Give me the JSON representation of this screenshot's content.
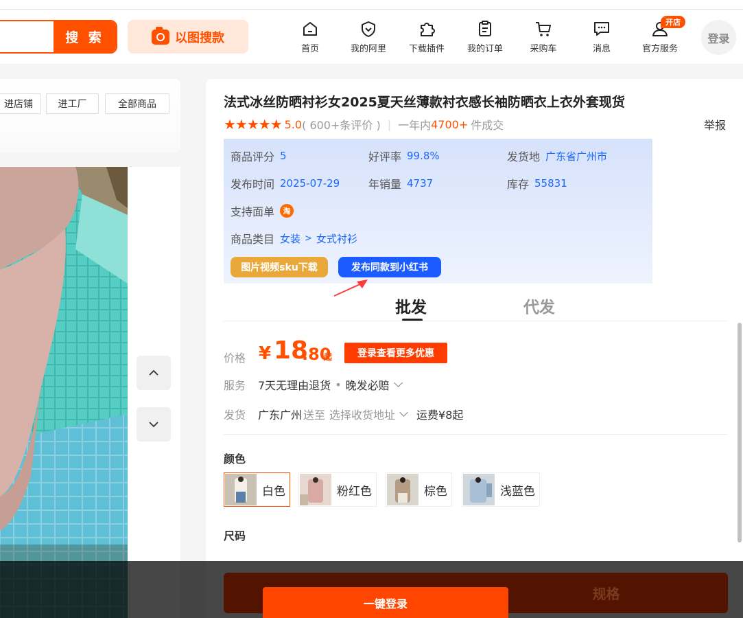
{
  "header": {
    "search_button": "搜 索",
    "image_search": "以图搜款",
    "nav": [
      {
        "label": "首页",
        "icon": "home-icon"
      },
      {
        "label": "我的阿里",
        "icon": "shield-heart-icon"
      },
      {
        "label": "下载插件",
        "icon": "puzzle-icon"
      },
      {
        "label": "我的订单",
        "icon": "clipboard-icon"
      },
      {
        "label": "采购车",
        "icon": "cart-icon"
      },
      {
        "label": "消息",
        "icon": "chat-icon"
      },
      {
        "label": "官方服务",
        "icon": "user-icon"
      }
    ],
    "open_badge": "开店",
    "login": "登录"
  },
  "shop_bar": {
    "buttons": [
      "进店铺",
      "进工厂",
      "全部商品"
    ]
  },
  "product": {
    "title": "法式冰丝防晒衬衫女2025夏天丝薄款衬衣感长袖防晒衣上衣外套现货",
    "stars": "★★★★★",
    "rating": "5.0",
    "review_count": "( 600+条评价 )",
    "divider": "|",
    "sales_prefix": "一年内",
    "sales_number": "4700+",
    "sales_suffix": "件成交",
    "report": "举报"
  },
  "info": {
    "score_label": "商品评分",
    "score_value": "5",
    "praise_label": "好评率",
    "praise_value": "99.8%",
    "origin_label": "发货地",
    "origin_value": "广东省广州市",
    "publish_label": "发布时间",
    "publish_value": "2025-07-29",
    "annual_label": "年销量",
    "annual_value": "4737",
    "stock_label": "库存",
    "stock_value": "55831",
    "waybill_label": "支持面单",
    "waybill_icon": "淘",
    "category_label": "商品类目",
    "category_1": "女装",
    "category_sep": ">",
    "category_2": "女式衬衫",
    "download_button": "图片视频sku下载",
    "xhs_button": "发布同款到小红书"
  },
  "tabs": {
    "wholesale": "批发",
    "dropship": "代发"
  },
  "price": {
    "label": "价格",
    "currency": "¥",
    "integer": "18",
    "decimal": ".80",
    "suffix": "起",
    "login_deal": "登录查看更多优惠"
  },
  "service": {
    "label": "服务",
    "item1": "7天无理由退货",
    "dot": "•",
    "item2": "晚发必赔"
  },
  "shipping": {
    "label": "发货",
    "from": "广东广州",
    "to_word": "送至",
    "address": "选择收货地址",
    "fee": "运费¥8起"
  },
  "color": {
    "label": "颜色",
    "options": [
      {
        "label": "白色",
        "selected": true
      },
      {
        "label": "粉红色",
        "selected": false
      },
      {
        "label": "棕色",
        "selected": false
      },
      {
        "label": "浅蓝色",
        "selected": false
      }
    ]
  },
  "size": {
    "label": "尺码"
  },
  "bottom": {
    "buy_text": "规格",
    "one_click_login": "一键登录"
  },
  "colors": {
    "accent": "#ff5000",
    "link": "#1a66ff",
    "xhs_button": "#1a5cff",
    "download_button": "#e8a93a"
  }
}
